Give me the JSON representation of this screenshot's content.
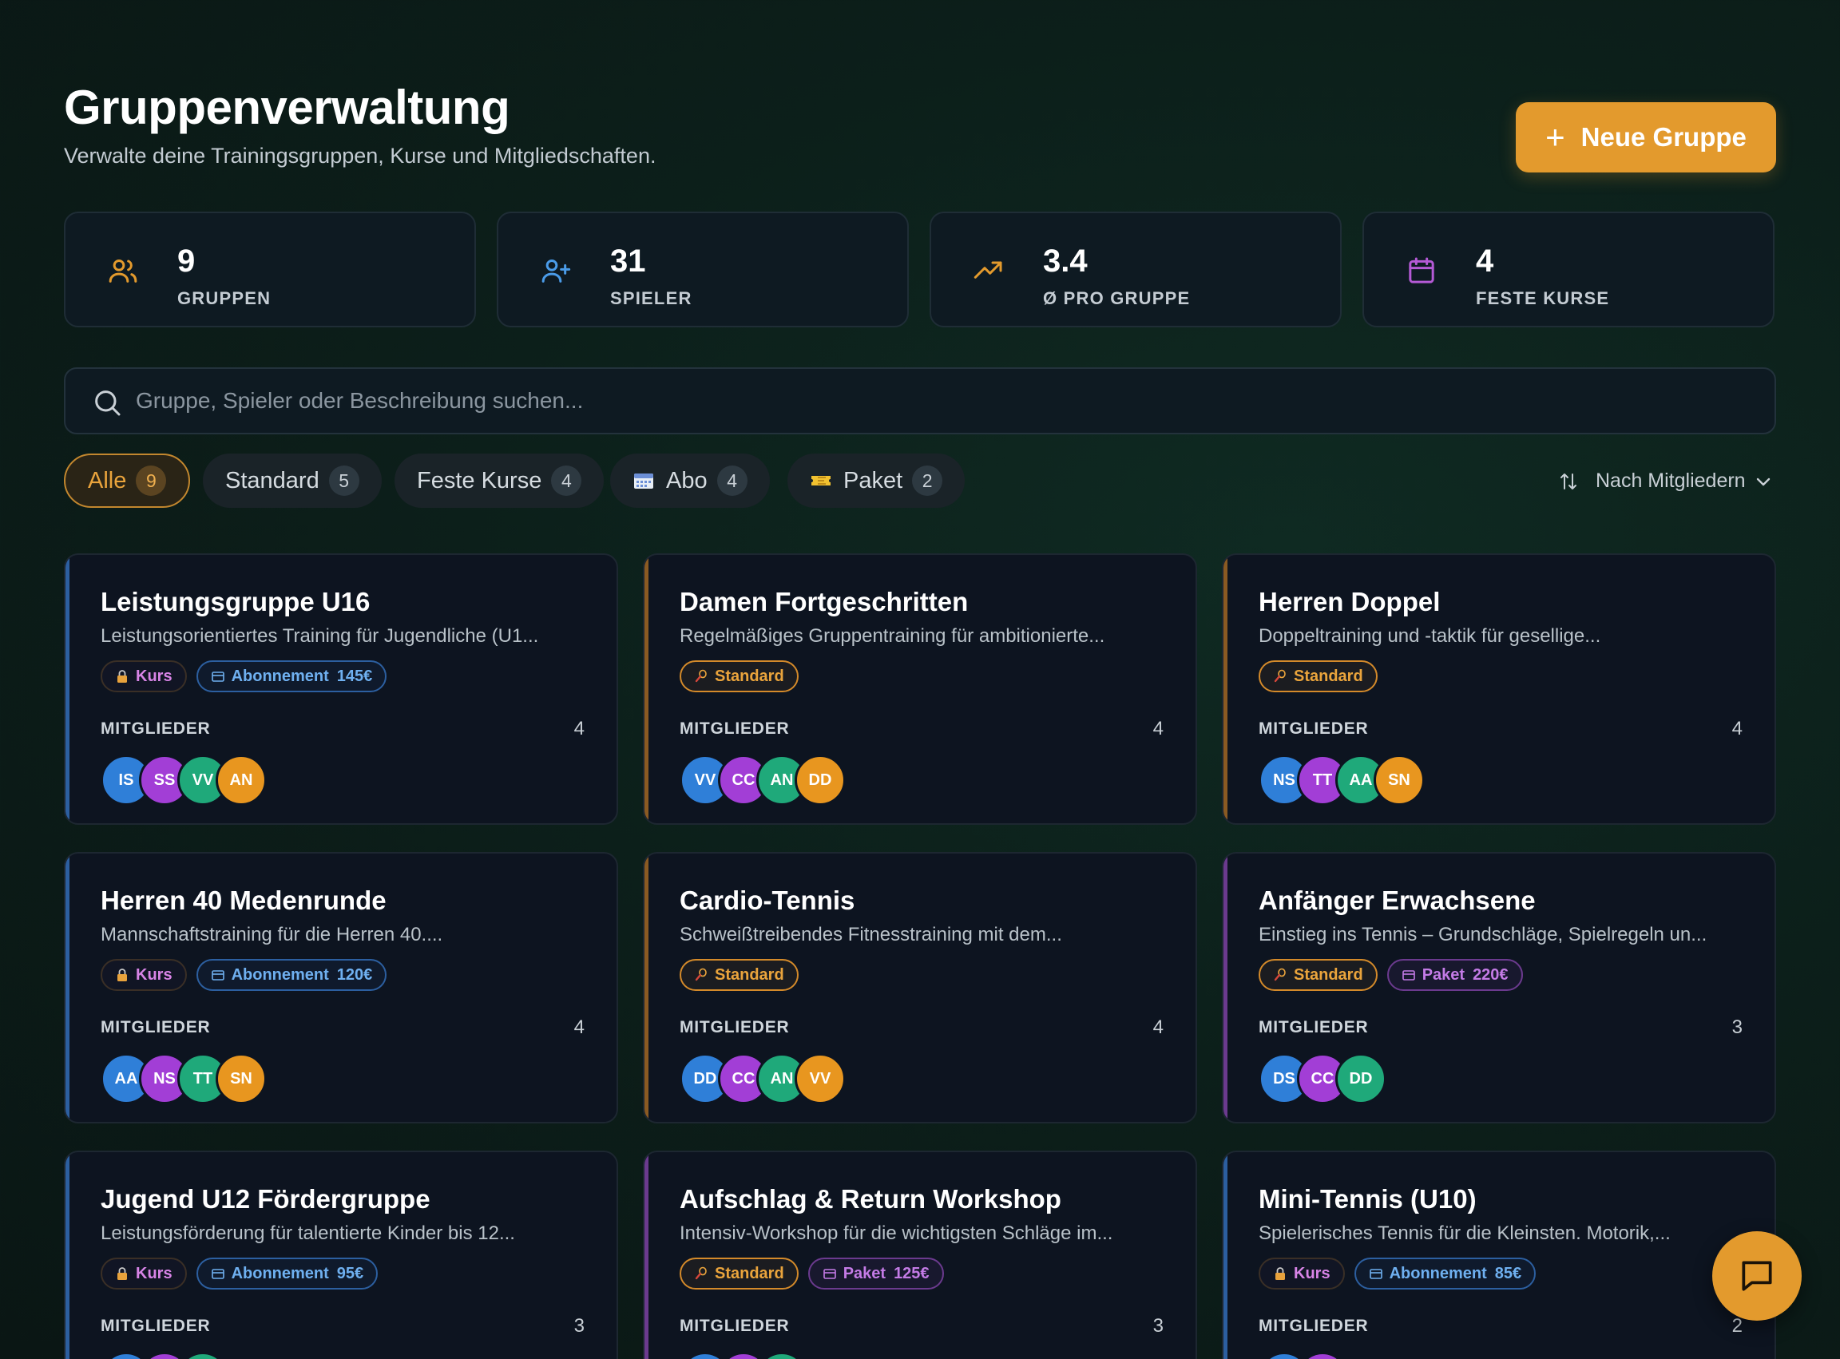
{
  "header": {
    "title": "Gruppenverwaltung",
    "subtitle": "Verwalte deine Trainingsgruppen, Kurse und Mitgliedschaften.",
    "new_button": "Neue Gruppe"
  },
  "stats": [
    {
      "value": "9",
      "label": "GRUPPEN",
      "icon": "users-icon",
      "color": "#e39a2d"
    },
    {
      "value": "31",
      "label": "SPIELER",
      "icon": "user-plus-icon",
      "color": "#4a9be8"
    },
    {
      "value": "3.4",
      "label": "Ø PRO GRUPPE",
      "icon": "trending-up-icon",
      "color": "#e39a2d"
    },
    {
      "value": "4",
      "label": "FESTE KURSE",
      "icon": "calendar-icon",
      "color": "#b55ad6"
    }
  ],
  "search": {
    "placeholder": "Gruppe, Spieler oder Beschreibung suchen..."
  },
  "filters": [
    {
      "label": "Alle",
      "count": "9"
    },
    {
      "label": "Standard",
      "count": "5"
    },
    {
      "label": "Feste Kurse",
      "count": "4"
    },
    {
      "label": "Abo",
      "count": "4",
      "icon": "calendar-emoji-icon"
    },
    {
      "label": "Paket",
      "count": "2",
      "icon": "ticket-emoji-icon"
    }
  ],
  "sort": {
    "label": "Nach Mitgliedern"
  },
  "members_label": "MITGLIEDER",
  "tag_labels": {
    "kurs": "Kurs",
    "abo": "Abonnement",
    "standard": "Standard",
    "paket": "Paket"
  },
  "groups": [
    {
      "name": "Leistungsgruppe U16",
      "desc": "Leistungsorientiertes Training für Jugendliche (U1...",
      "tags": [
        {
          "type": "kurs"
        },
        {
          "type": "abo",
          "price": "145€"
        }
      ],
      "count": "4",
      "members": [
        "IS",
        "SS",
        "VV",
        "AN"
      ],
      "accent": "#2c5fa0"
    },
    {
      "name": "Damen Fortgeschritten",
      "desc": "Regelmäßiges Gruppentraining für ambitionierte...",
      "tags": [
        {
          "type": "standard"
        }
      ],
      "count": "4",
      "members": [
        "VV",
        "CC",
        "AN",
        "DD"
      ],
      "accent": "#8a5a22"
    },
    {
      "name": "Herren Doppel",
      "desc": "Doppeltraining und -taktik für gesellige...",
      "tags": [
        {
          "type": "standard"
        }
      ],
      "count": "4",
      "members": [
        "NS",
        "TT",
        "AA",
        "SN"
      ],
      "accent": "#8a5a22"
    },
    {
      "name": "Herren 40 Medenrunde",
      "desc": "Mannschaftstraining für die Herren 40....",
      "tags": [
        {
          "type": "kurs"
        },
        {
          "type": "abo",
          "price": "120€"
        }
      ],
      "count": "4",
      "members": [
        "AA",
        "NS",
        "TT",
        "SN"
      ],
      "accent": "#2c5fa0"
    },
    {
      "name": "Cardio-Tennis",
      "desc": "Schweißtreibendes Fitnesstraining mit dem...",
      "tags": [
        {
          "type": "standard"
        }
      ],
      "count": "4",
      "members": [
        "DD",
        "CC",
        "AN",
        "VV"
      ],
      "accent": "#8a5a22"
    },
    {
      "name": "Anfänger Erwachsene",
      "desc": "Einstieg ins Tennis – Grundschläge, Spielregeln un...",
      "tags": [
        {
          "type": "standard"
        },
        {
          "type": "paket",
          "price": "220€"
        }
      ],
      "count": "3",
      "members": [
        "DS",
        "CC",
        "DD"
      ],
      "accent": "#6b3a8e"
    },
    {
      "name": "Jugend U12 Fördergruppe",
      "desc": "Leistungsförderung für talentierte Kinder bis 12...",
      "tags": [
        {
          "type": "kurs"
        },
        {
          "type": "abo",
          "price": "95€"
        }
      ],
      "count": "3",
      "members": [
        "",
        "",
        ""
      ],
      "accent": "#2c5fa0"
    },
    {
      "name": "Aufschlag & Return Workshop",
      "desc": "Intensiv-Workshop für die wichtigsten Schläge im...",
      "tags": [
        {
          "type": "standard"
        },
        {
          "type": "paket",
          "price": "125€"
        }
      ],
      "count": "3",
      "members": [
        "",
        "",
        ""
      ],
      "accent": "#6b3a8e"
    },
    {
      "name": "Mini-Tennis (U10)",
      "desc": "Spielerisches Tennis für die Kleinsten. Motorik,...",
      "tags": [
        {
          "type": "kurs"
        },
        {
          "type": "abo",
          "price": "85€"
        }
      ],
      "count": "2",
      "members": [
        "",
        ""
      ],
      "accent": "#2c5fa0"
    }
  ],
  "colors": {
    "accent": "#e39a2d",
    "background": "#0c1f1a",
    "card": "#0d1420"
  },
  "fab": {
    "icon": "chat-icon"
  }
}
